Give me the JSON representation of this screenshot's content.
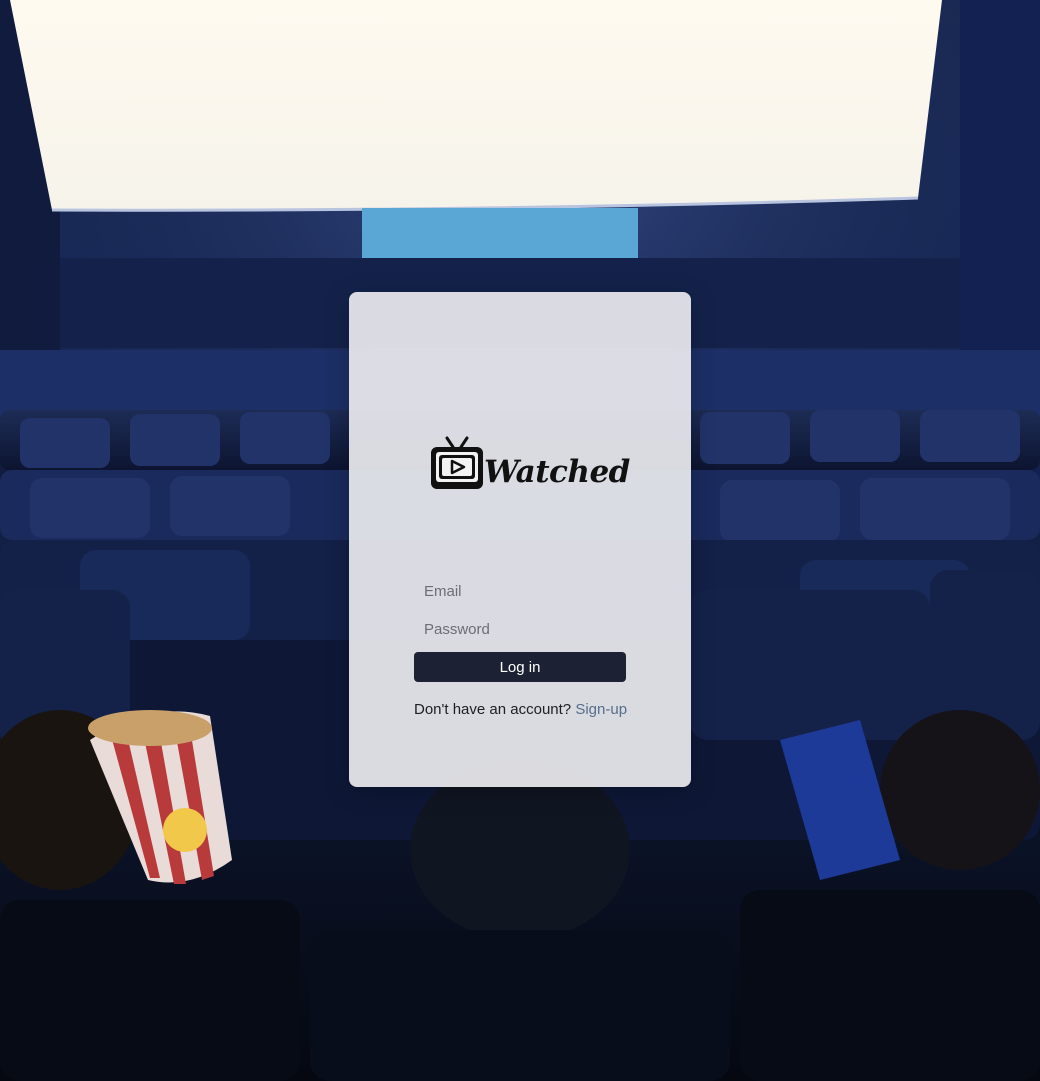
{
  "brand": {
    "name": "Watched",
    "logo_icon": "tv-play-icon"
  },
  "login_form": {
    "email_placeholder": "Email",
    "password_placeholder": "Password",
    "login_label": "Log in",
    "signup_prompt": "Don't have an account?",
    "signup_link": "Sign-up"
  },
  "background": {
    "description_icon": "cinema-background-image"
  },
  "colors": {
    "button_bg": "#1c2233",
    "link": "#556e8c",
    "card_bg": "#e9eaee"
  }
}
